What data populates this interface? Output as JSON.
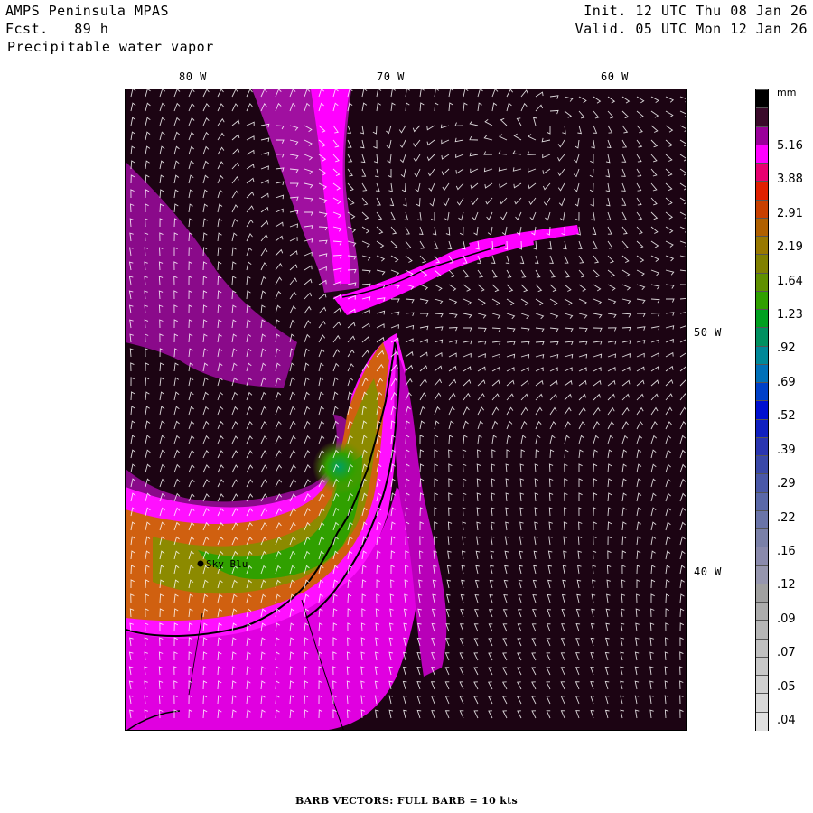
{
  "header": {
    "title": "AMPS Peninsula MPAS",
    "forecast": "Fcst.   89 h",
    "field": "Precipitable water vapor",
    "init": "Init. 12 UTC Thu 08 Jan 26",
    "valid": "Valid. 05 UTC Mon 12 Jan 26"
  },
  "map": {
    "longitude_labels": [
      "80 W",
      "70 W",
      "60 W"
    ],
    "latitude_labels": [
      "50 W",
      "40 W"
    ],
    "station_label": "Sky Blu",
    "background_color": "#1c0413"
  },
  "legend": {
    "units": "mm",
    "labels": [
      "5.16",
      "3.88",
      "2.91",
      "2.19",
      "1.64",
      "1.23",
      ".92",
      ".69",
      ".52",
      ".39",
      ".29",
      ".22",
      ".16",
      ".12",
      ".09",
      ".07",
      ".05",
      ".04"
    ],
    "colors_top_to_bottom": [
      "#000000",
      "#3a0a2a",
      "#9a009a",
      "#ff00ff",
      "#e80070",
      "#e02000",
      "#c84000",
      "#b06000",
      "#987800",
      "#808000",
      "#609000",
      "#30a000",
      "#00a020",
      "#009060",
      "#008898",
      "#0070b8",
      "#0040c8",
      "#0010d0",
      "#1020c0",
      "#2a35b0",
      "#3a48a8",
      "#4a58a8",
      "#5a68a8",
      "#6a74a8",
      "#7a80a8",
      "#8a8aac",
      "#9696ae",
      "#a0a0a0",
      "#acacac",
      "#b6b6b6",
      "#c0c0c0",
      "#c8c8c8",
      "#d0d0d0",
      "#d8d8d8",
      "#e0e0e0"
    ]
  },
  "footer": {
    "note": "BARB VECTORS:  FULL BARB = 10 kts"
  }
}
